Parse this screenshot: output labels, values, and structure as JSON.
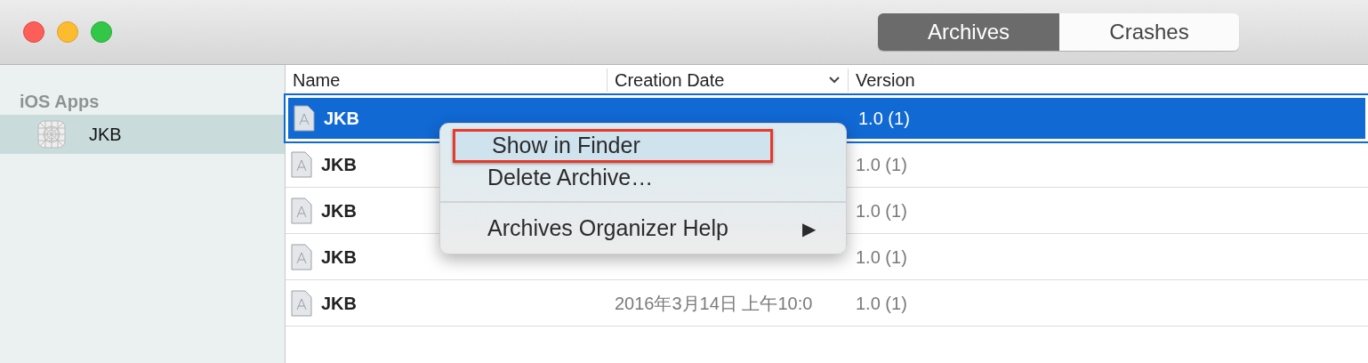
{
  "window": {
    "tabs": [
      {
        "label": "Archives",
        "selected": true
      },
      {
        "label": "Crashes",
        "selected": false
      }
    ]
  },
  "sidebar": {
    "section": "iOS Apps",
    "items": [
      {
        "label": "JKB",
        "selected": true
      }
    ]
  },
  "table": {
    "columns": [
      {
        "label": "Name",
        "sorted": false
      },
      {
        "label": "Creation Date",
        "sorted": true
      },
      {
        "label": "Version",
        "sorted": false
      }
    ],
    "rows": [
      {
        "name": "JKB",
        "version": "1.0 (1)",
        "selected": true
      },
      {
        "name": "JKB",
        "version": "1.0 (1)",
        "selected": false
      },
      {
        "name": "JKB",
        "version": "1.0 (1)",
        "selected": false
      },
      {
        "name": "JKB",
        "version": "1.0 (1)",
        "selected": false
      },
      {
        "name": "JKB",
        "date": "2016年3月14日 上午10:0",
        "version": "1.0 (1)",
        "selected": false
      }
    ]
  },
  "context_menu": {
    "items": [
      {
        "kind": "item",
        "label": "Show in Finder",
        "selected": true
      },
      {
        "kind": "item",
        "label": "Delete Archive…",
        "selected": false
      },
      {
        "kind": "separator"
      },
      {
        "kind": "submenu",
        "label": "Archives Organizer Help",
        "arrow": "▶",
        "selected": false
      }
    ]
  }
}
